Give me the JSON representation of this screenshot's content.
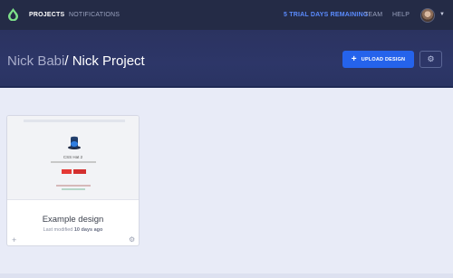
{
  "nav": {
    "projects": "PROJECTS",
    "notifications": "NOTIFICATIONS",
    "trial": "5 TRIAL DAYS REMAINING",
    "team": "TEAM",
    "help": "HELP"
  },
  "header": {
    "user": "Nick Babi",
    "separator": "/",
    "project": " Nick Project",
    "upload_label": "UPLOAD DESIGN"
  },
  "card": {
    "title": "Example design",
    "meta_prefix": "Last modified ",
    "meta_time": "10 days ago",
    "thumbnail_title": "CSS Hat 2"
  },
  "colors": {
    "accent": "#2563eb",
    "topbar": "#242b46",
    "header": "#2d3668",
    "trial": "#5b8cff"
  },
  "icons": {
    "logo": "drop-logo-icon",
    "upload": "plus-icon",
    "settings": "gear-icon",
    "avatar_caret": "chevron-down-icon",
    "card_add": "plus-icon",
    "card_settings": "gear-icon"
  }
}
